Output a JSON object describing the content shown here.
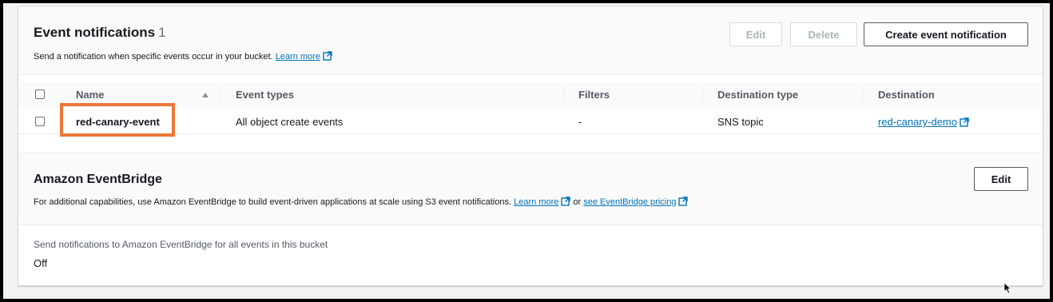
{
  "event_notifications": {
    "title": "Event notifications",
    "count": "1",
    "description": "Send a notification when specific events occur in your bucket.",
    "learn_more": "Learn more",
    "buttons": {
      "edit": "Edit",
      "delete": "Delete",
      "create": "Create event notification"
    },
    "columns": [
      "Name",
      "Event types",
      "Filters",
      "Destination type",
      "Destination"
    ],
    "rows": [
      {
        "name": "red-canary-event",
        "event_types": "All object create events",
        "filters": "-",
        "destination_type": "SNS topic",
        "destination": "red-canary-demo"
      }
    ]
  },
  "eventbridge": {
    "title": "Amazon EventBridge",
    "description": "For additional capabilities, use Amazon EventBridge to build event-driven applications at scale using S3 event notifications.",
    "learn_more": "Learn more",
    "or": "or",
    "pricing_link": "see EventBridge pricing",
    "edit": "Edit",
    "setting_label": "Send notifications to Amazon EventBridge for all events in this bucket",
    "setting_value": "Off"
  },
  "colors": {
    "link": "#0073bb",
    "highlight": "#ec7737",
    "header_bg": "#fafafa"
  },
  "icons": [
    "external-link-icon",
    "sort-ascending-icon",
    "checkbox-icon",
    "mouse-cursor-icon"
  ]
}
